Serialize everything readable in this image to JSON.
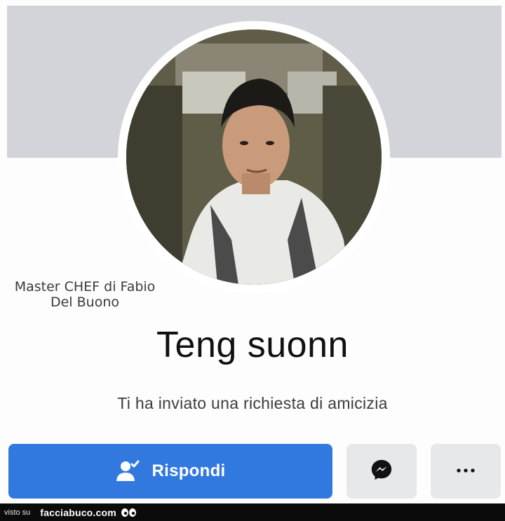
{
  "profile": {
    "name": "Teng suonn",
    "subtitle": "Ti ha inviato una richiesta di amicizia",
    "overlay_caption_line1": "Master CHEF  di Fabio",
    "overlay_caption_line2": "Del Buono"
  },
  "actions": {
    "respond_label": "Rispondi",
    "respond_icon": "person-check-icon",
    "messenger_icon": "messenger-icon",
    "more_icon": "more-horizontal-icon"
  },
  "footer": {
    "seen_on": "visto su",
    "site": "facciabuco.com"
  },
  "colors": {
    "primary": "#3279df",
    "secondary_button": "#e7e8ec",
    "cover": "#d2d4d9"
  }
}
